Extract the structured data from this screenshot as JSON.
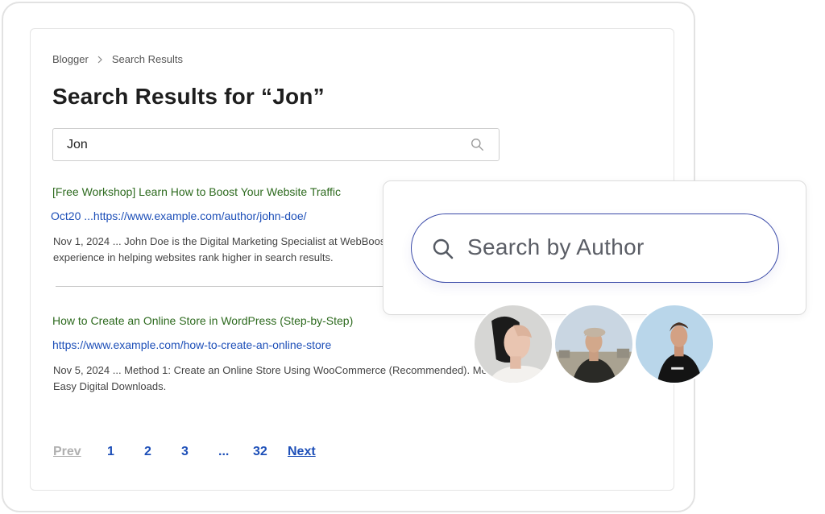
{
  "breadcrumb": {
    "root": "Blogger",
    "current": "Search Results"
  },
  "page_title": "Search Results for “Jon”",
  "search": {
    "value": "Jon",
    "icon": "search-icon"
  },
  "results": [
    {
      "title": "[Free Workshop] Learn How to Boost Your Website Traffic",
      "url": "Oct20 ...https://www.example.com/author/john-doe/",
      "snippet_line1": "Nov 1, 2024 ... John Doe is the Digital Marketing Specialist at WebBoost,",
      "snippet_line2": "experience in helping websites rank higher in search results."
    },
    {
      "title": "How to Create an Online Store in WordPress (Step-by-Step)",
      "url": "https://www.example.com/how-to-create-an-online-store",
      "snippet_line1": "Nov 5, 2024 ... Method 1: Create an Online Store Using WooCommerce (Recommended). Me",
      "snippet_line2": "Easy Digital Downloads."
    }
  ],
  "pagination": {
    "prev": "Prev",
    "p1": "1",
    "p2": "2",
    "p3": "3",
    "dots": "...",
    "last": "32",
    "next": "Next"
  },
  "author_search": {
    "placeholder": "Search by Author",
    "icon": "search-icon"
  },
  "colors": {
    "result_title": "#2d6a1e",
    "link": "#1d4fb8",
    "author_border": "#3a4aa8",
    "disabled": "#b0b0b0"
  }
}
